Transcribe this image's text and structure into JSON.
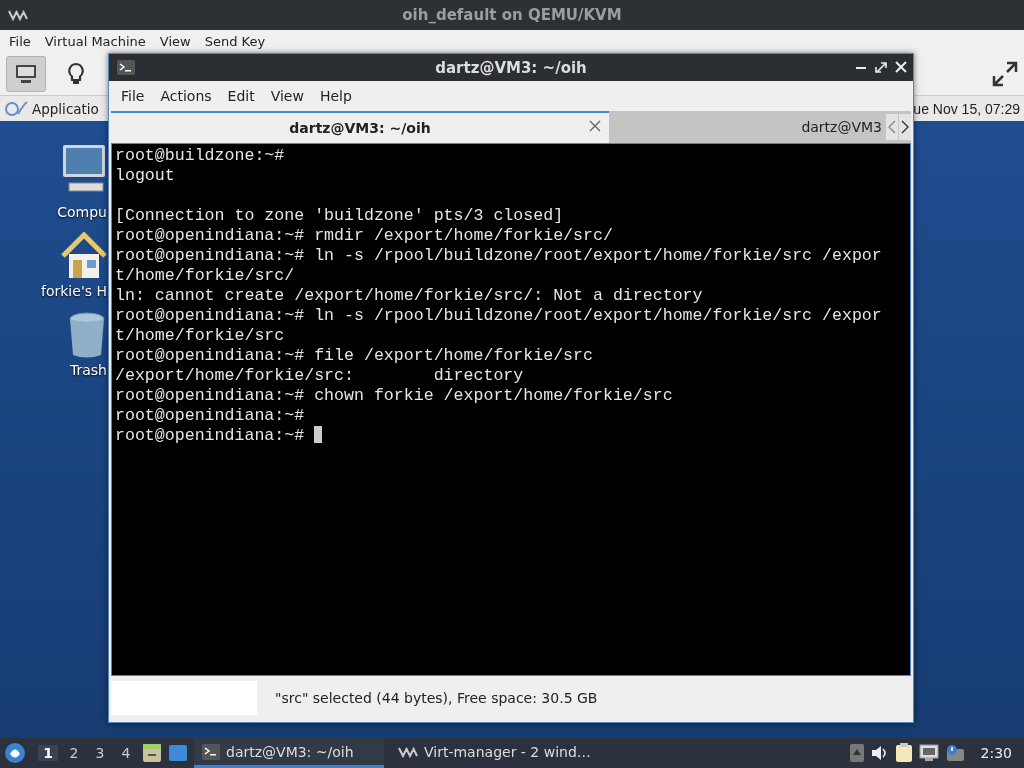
{
  "qemu_window": {
    "title": "oih_default on QEMU/KVM",
    "menu": [
      "File",
      "Virtual Machine",
      "View",
      "Send Key"
    ],
    "toolbar": [
      {
        "kind": "console",
        "selected": true
      },
      {
        "kind": "details",
        "selected": false
      }
    ]
  },
  "guest_panel": {
    "applications": "Applicatio",
    "clock": "ue Nov 15, 07:29"
  },
  "desktop_icons": [
    {
      "kind": "computer",
      "label": "Compu"
    },
    {
      "kind": "home",
      "label": "forkie's H"
    },
    {
      "kind": "trash",
      "label": "Trash"
    }
  ],
  "terminal": {
    "title": "dartz@VM3: ~/oih",
    "menu": [
      "File",
      "Actions",
      "Edit",
      "View",
      "Help"
    ],
    "tabs": [
      {
        "label": "dartz@VM3: ~/oih",
        "selected": true
      },
      {
        "label": "dartz@VM3",
        "selected": false
      }
    ],
    "blocks": [
      [
        "root@buildzone:~#",
        "logout"
      ],
      [
        "[Connection to zone 'buildzone' pts/3 closed]",
        "root@openindiana:~# rmdir /export/home/forkie/src/",
        "root@openindiana:~# ln -s /rpool/buildzone/root/export/home/forkie/src /expor",
        "t/home/forkie/src/",
        "ln: cannot create /export/home/forkie/src/: Not a directory",
        "root@openindiana:~# ln -s /rpool/buildzone/root/export/home/forkie/src /expor",
        "t/home/forkie/src",
        "root@openindiana:~# file /export/home/forkie/src",
        "/export/home/forkie/src:        directory",
        "root@openindiana:~# chown forkie /export/home/forkie/src",
        "root@openindiana:~#",
        "root@openindiana:~# "
      ]
    ],
    "cursor": true,
    "status": "\"src\" selected (44 bytes), Free space: 30.5 GB"
  },
  "taskbar": {
    "workspaces": [
      {
        "label": "1",
        "selected": true
      },
      {
        "label": "2",
        "selected": false
      },
      {
        "label": "3",
        "selected": false
      },
      {
        "label": "4",
        "selected": false
      }
    ],
    "launchers": [
      {
        "kind": "files"
      },
      {
        "kind": "desktop"
      }
    ],
    "tasks": [
      {
        "kind": "terminal",
        "label": "dartz@VM3: ~/oih",
        "selected": true
      },
      {
        "kind": "virt",
        "label": "Virt-manager - 2 wind…",
        "selected": false
      }
    ],
    "tray": [
      {
        "kind": "up"
      },
      {
        "kind": "volume"
      },
      {
        "kind": "clipboard"
      },
      {
        "kind": "network"
      },
      {
        "kind": "notify"
      }
    ],
    "clock": "2:30"
  }
}
